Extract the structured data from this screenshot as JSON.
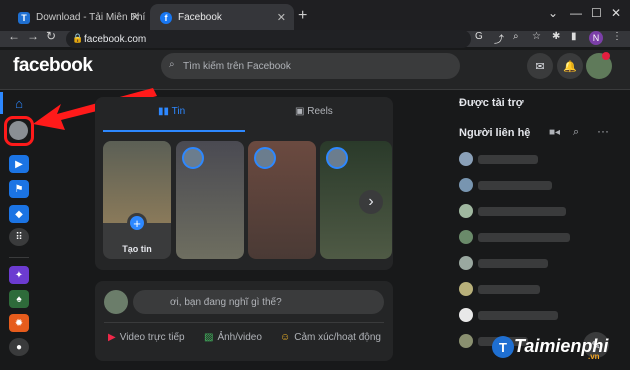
{
  "browser": {
    "tabs": [
      {
        "label": "Download - Tải Miễn Phí VN - Ph",
        "favicon": "T"
      },
      {
        "label": "Facebook",
        "favicon": "f"
      }
    ],
    "new_tab": "+",
    "url": "facebook.com",
    "profile_initial": "N"
  },
  "fb": {
    "logo": "facebook",
    "search_placeholder": "Tìm kiếm trên Facebook",
    "stories": {
      "tab_news": "Tin",
      "tab_reels": "Reels",
      "create_label": "Tạo tin",
      "next": "›"
    },
    "composer": {
      "placeholder": "ơi, bạn đang nghĩ gì thế?",
      "actions": [
        "Video trực tiếp",
        "Ảnh/video",
        "Cảm xúc/hoạt động"
      ]
    },
    "right": {
      "sponsored": "Được tài trợ",
      "contacts_title": "Người liên hệ"
    }
  },
  "watermark": {
    "main": "Taimienphi",
    "sub": ".vn"
  },
  "colors": {
    "accent": "#2d88ff",
    "highlight": "#ff1a1a"
  }
}
